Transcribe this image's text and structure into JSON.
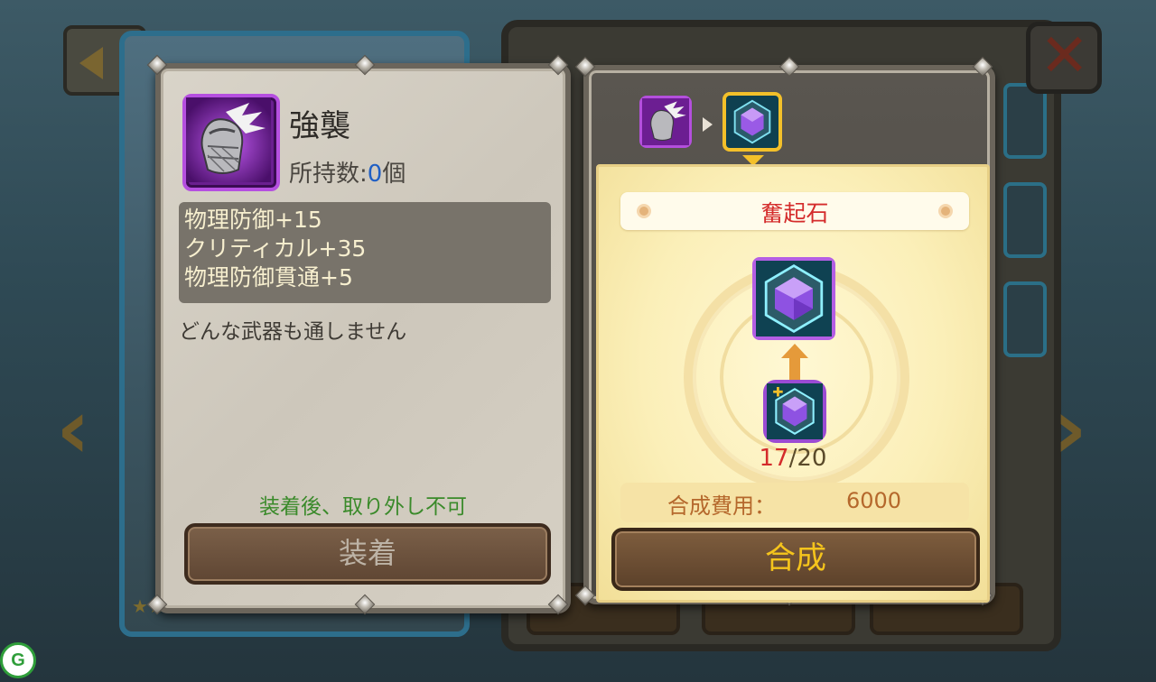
{
  "item": {
    "name": "強襲",
    "owned_label": "所持数:",
    "owned_count": "0",
    "owned_unit": "個",
    "stats": [
      "物理防御+15",
      "クリティカル+35",
      "物理防御貫通+5"
    ],
    "description": "どんな武器も通しません",
    "equip_note": "装着後、取り外し不可",
    "equip_button": "装着",
    "icon": "gauntlet-icon"
  },
  "craft": {
    "target_name": "奮起石",
    "material_have": "17",
    "material_separator": "/",
    "material_need": "20",
    "cost_label": "合成費用：",
    "cost_value": "6000",
    "craft_button": "合成",
    "target_icon": "purple-gem-icon"
  },
  "background": {
    "logo_letter": "G"
  },
  "colors": {
    "epic_purple": "#b54fe0",
    "selected_gold": "#f3c02a",
    "count_red": "#d42b2b",
    "note_green": "#3a8a2a",
    "owned_blue": "#1f5fc4",
    "craft_text": "#f5c41c"
  }
}
